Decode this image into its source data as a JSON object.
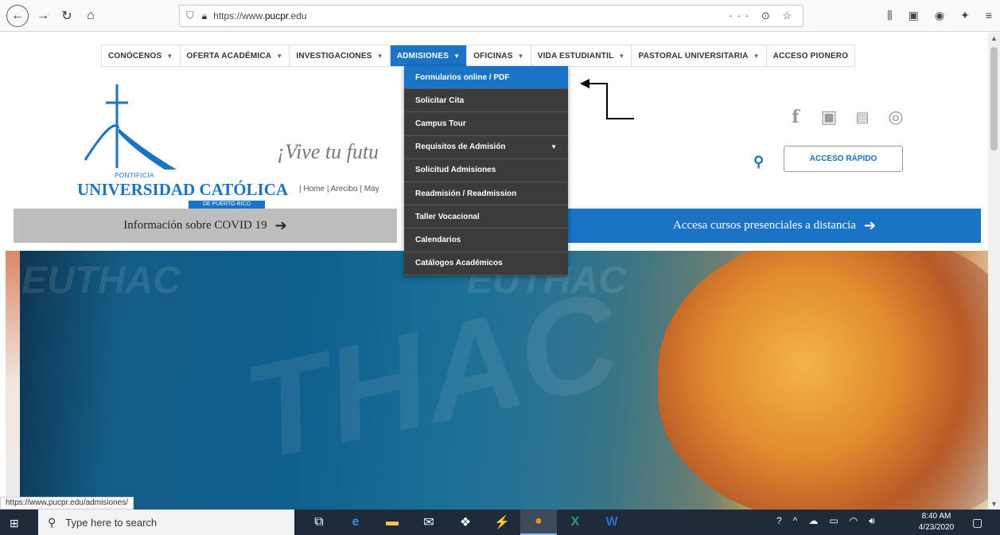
{
  "browser": {
    "url_prefix": "https://www.",
    "url_domain": "pucpr",
    "url_suffix": ".edu",
    "url_actions": "··· ⊙ ☆",
    "status_url": "https://www.pucpr.edu/admisiones/"
  },
  "nav": {
    "items": [
      {
        "label": "CONÓCENOS"
      },
      {
        "label": "OFERTA ACADÉMICA"
      },
      {
        "label": "INVESTIGACIONES"
      },
      {
        "label": "ADMISIONES",
        "active": true
      },
      {
        "label": "OFICINAS"
      },
      {
        "label": "VIDA ESTUDIANTIL"
      },
      {
        "label": "PASTORAL UNIVERSITARIA"
      },
      {
        "label": "ACCESO PIONERO"
      }
    ]
  },
  "dropdown": {
    "items": [
      {
        "label": "Formularios online / PDF",
        "highlighted": true
      },
      {
        "label": "Solicitar Cita"
      },
      {
        "label": "Campus Tour"
      },
      {
        "label": "Requisitos de Admisión",
        "has_submenu": true
      },
      {
        "label": "Solicitud Admisiones"
      },
      {
        "label": "Readmisión / Readmission"
      },
      {
        "label": "Taller Vocacional"
      },
      {
        "label": "Calendarios"
      },
      {
        "label": "Catálogos Académicos"
      }
    ]
  },
  "logo": {
    "pontificia": "PONTIFICIA",
    "name": "UNIVERSIDAD CATÓLICA",
    "subtitle": "DE PUERTO RICO"
  },
  "tagline": "¡Vive tu futu",
  "quicklinks": "|  Home  |  Arecibo  |  May",
  "header_right": {
    "acceso_rapido": "ACCESO RÁPIDO"
  },
  "banners": {
    "covid": "Información sobre COVID 19",
    "cursos": "Accesa cursos presenciales a distancia"
  },
  "hero": {
    "watermark_1": "EUTHAC",
    "watermark_2": "THAC"
  },
  "taskbar": {
    "search_placeholder": "Type here to search",
    "time": "8:40 AM",
    "date": "4/23/2020"
  },
  "colors": {
    "accent": "#1a73c5",
    "dropdown_bg": "#3b3b3b",
    "covid_banner": "#bdbdbd"
  }
}
